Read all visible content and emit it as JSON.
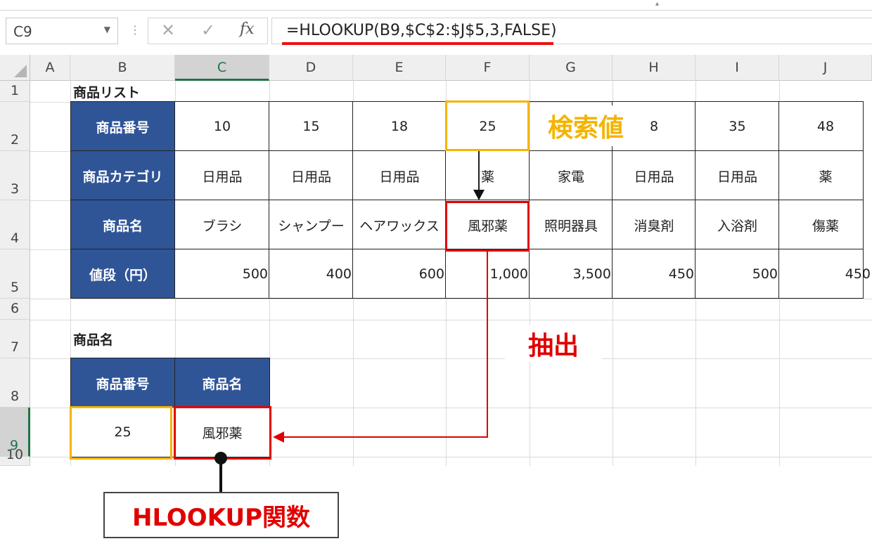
{
  "formula_bar": {
    "name_box": "C9",
    "cancel_icon": "✕",
    "enter_icon": "✓",
    "fx_label": "fx",
    "formula": "=HLOOKUP(B9,$C$2:$J$5,3,FALSE)"
  },
  "columns": [
    "A",
    "B",
    "C",
    "D",
    "E",
    "F",
    "G",
    "H",
    "I",
    "J"
  ],
  "rows": [
    "1",
    "2",
    "3",
    "4",
    "5",
    "6",
    "7",
    "8",
    "9",
    "10"
  ],
  "sheet": {
    "title1": "商品リスト",
    "table1": {
      "row_labels": [
        "商品番号",
        "商品カテゴリ",
        "商品名",
        "値段（円）"
      ],
      "product_numbers": [
        "10",
        "15",
        "18",
        "25",
        "8",
        "35",
        "48"
      ],
      "categories": [
        "日用品",
        "日用品",
        "日用品",
        "薬",
        "家電",
        "日用品",
        "日用品",
        "薬"
      ],
      "names": [
        "ブラシ",
        "シャンプー",
        "ヘアワックス",
        "風邪薬",
        "照明器具",
        "消臭剤",
        "入浴剤",
        "傷薬"
      ],
      "prices": [
        "500",
        "400",
        "600",
        "1,000",
        "3,500",
        "450",
        "500",
        "450"
      ]
    },
    "title2": "商品名",
    "table2": {
      "headers": [
        "商品番号",
        "商品名"
      ],
      "values": [
        "25",
        "風邪薬"
      ]
    }
  },
  "annotations": {
    "search_value": "検索値",
    "extract": "抽出",
    "function_label": "HLOOKUP関数",
    "colors": {
      "orange": "#f4b400",
      "red": "#e00000",
      "header_blue": "#2f5597"
    }
  }
}
